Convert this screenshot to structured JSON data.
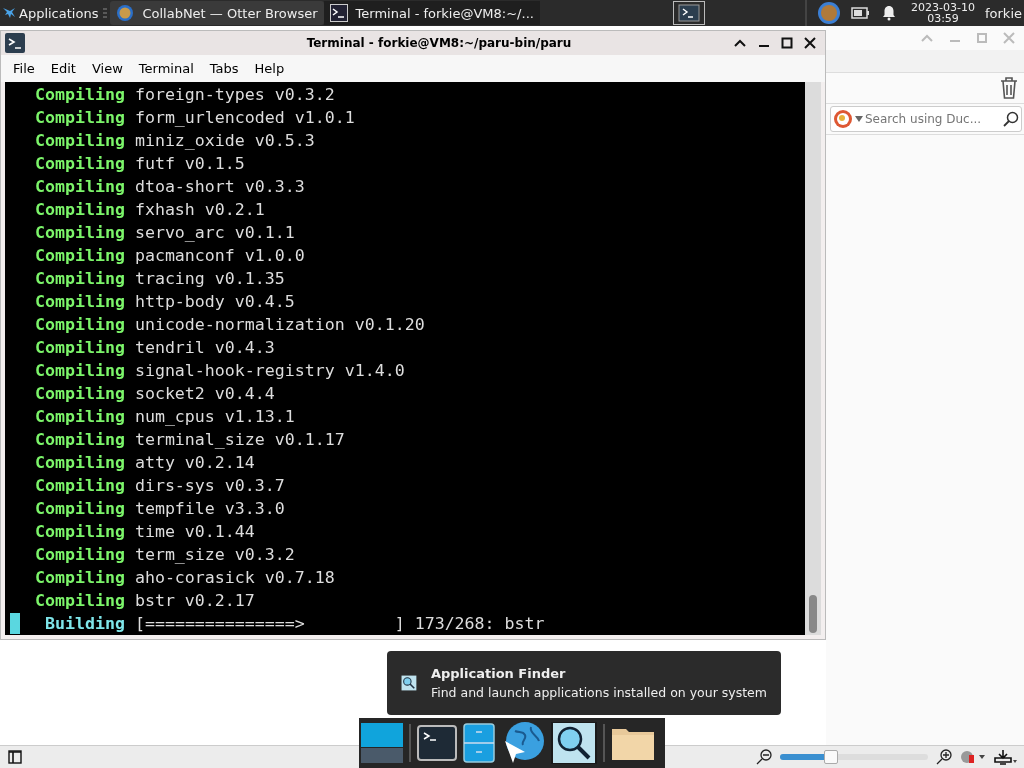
{
  "top_panel": {
    "applications_label": "Applications",
    "tasks": [
      {
        "kind": "browser",
        "label": "CollabNet — Otter Browser",
        "selected": false
      },
      {
        "kind": "terminal",
        "label": "Terminal - forkie@VM8:~/...",
        "selected": true
      }
    ],
    "date": "2023-03-10",
    "time": "03:59",
    "user": "forkie"
  },
  "browser": {
    "search": {
      "placeholder": "Search using Duc..."
    },
    "zoom": {
      "level": 0.34
    }
  },
  "terminal": {
    "title": "Terminal - forkie@VM8:~/paru-bin/paru",
    "menu": [
      "File",
      "Edit",
      "View",
      "Terminal",
      "Tabs",
      "Help"
    ],
    "lines": [
      {
        "kind": "compiling",
        "verb": "Compiling",
        "text": "foreign-types v0.3.2"
      },
      {
        "kind": "compiling",
        "verb": "Compiling",
        "text": "form_urlencoded v1.0.1"
      },
      {
        "kind": "compiling",
        "verb": "Compiling",
        "text": "miniz_oxide v0.5.3"
      },
      {
        "kind": "compiling",
        "verb": "Compiling",
        "text": "futf v0.1.5"
      },
      {
        "kind": "compiling",
        "verb": "Compiling",
        "text": "dtoa-short v0.3.3"
      },
      {
        "kind": "compiling",
        "verb": "Compiling",
        "text": "fxhash v0.2.1"
      },
      {
        "kind": "compiling",
        "verb": "Compiling",
        "text": "servo_arc v0.1.1"
      },
      {
        "kind": "compiling",
        "verb": "Compiling",
        "text": "pacmanconf v1.0.0"
      },
      {
        "kind": "compiling",
        "verb": "Compiling",
        "text": "tracing v0.1.35"
      },
      {
        "kind": "compiling",
        "verb": "Compiling",
        "text": "http-body v0.4.5"
      },
      {
        "kind": "compiling",
        "verb": "Compiling",
        "text": "unicode-normalization v0.1.20"
      },
      {
        "kind": "compiling",
        "verb": "Compiling",
        "text": "tendril v0.4.3"
      },
      {
        "kind": "compiling",
        "verb": "Compiling",
        "text": "signal-hook-registry v1.4.0"
      },
      {
        "kind": "compiling",
        "verb": "Compiling",
        "text": "socket2 v0.4.4"
      },
      {
        "kind": "compiling",
        "verb": "Compiling",
        "text": "num_cpus v1.13.1"
      },
      {
        "kind": "compiling",
        "verb": "Compiling",
        "text": "terminal_size v0.1.17"
      },
      {
        "kind": "compiling",
        "verb": "Compiling",
        "text": "atty v0.2.14"
      },
      {
        "kind": "compiling",
        "verb": "Compiling",
        "text": "dirs-sys v0.3.7"
      },
      {
        "kind": "compiling",
        "verb": "Compiling",
        "text": "tempfile v3.3.0"
      },
      {
        "kind": "compiling",
        "verb": "Compiling",
        "text": "time v0.1.44"
      },
      {
        "kind": "compiling",
        "verb": "Compiling",
        "text": "term_size v0.3.2"
      },
      {
        "kind": "compiling",
        "verb": "Compiling",
        "text": "aho-corasick v0.7.18"
      },
      {
        "kind": "compiling",
        "verb": "Compiling",
        "text": "bstr v0.2.17"
      },
      {
        "kind": "building",
        "verb": "Building",
        "text": "[===============>         ] 173/268: bstr"
      }
    ]
  },
  "notification": {
    "title": "Application Finder",
    "body": "Find and launch applications installed on your system"
  }
}
